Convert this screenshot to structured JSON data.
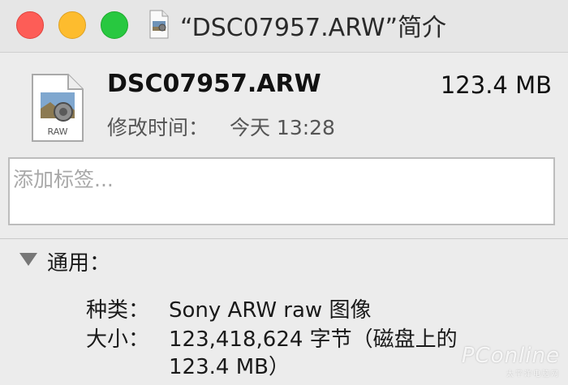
{
  "window": {
    "title": "“DSC07957.ARW”简介",
    "controls": {
      "close": "close-button",
      "minimize": "minimize-button",
      "zoom": "zoom-button"
    }
  },
  "header": {
    "file_name": "DSC07957.ARW",
    "file_size": "123.4 MB",
    "modified_label": "修改时间：",
    "modified_value": "今天 13:28",
    "file_icon": "raw-image-file-icon",
    "file_icon_badge": "RAW"
  },
  "tags": {
    "placeholder": "添加标签..."
  },
  "general": {
    "title": "通用：",
    "rows": [
      {
        "label": "种类：",
        "value": "Sony ARW raw 图像"
      },
      {
        "label": "大小：",
        "value": "123,418,624 字节（磁盘上的",
        "value_line2": "123.4 MB）"
      }
    ]
  },
  "watermark": {
    "main": "PConline",
    "sub": "太平洋电脑网"
  },
  "colors": {
    "close": "#fd5d57",
    "minimize": "#fdbc2e",
    "zoom": "#28c840",
    "background": "#ececec"
  }
}
